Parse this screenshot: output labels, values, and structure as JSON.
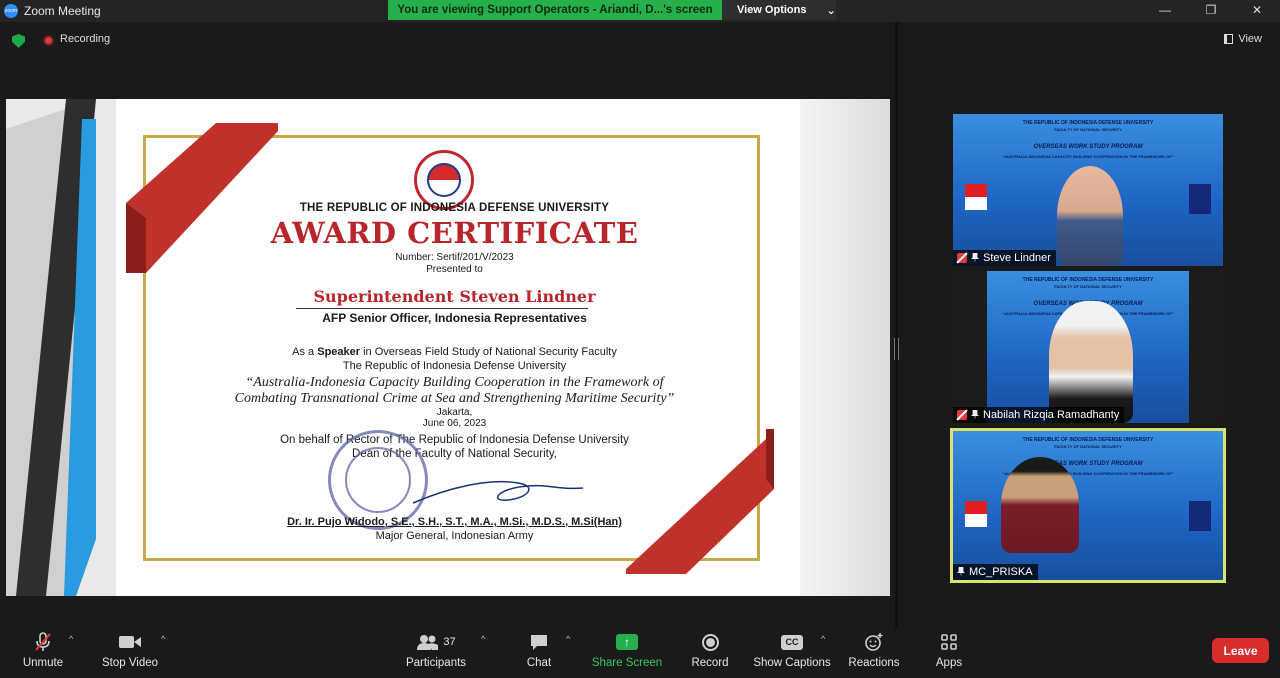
{
  "window": {
    "app_logo": "zoom",
    "title": "Zoom Meeting",
    "share_banner": "You are viewing Support Operators - Ariandi, D...'s screen",
    "view_options": "View Options",
    "controls": {
      "minimize": "—",
      "restore": "❐",
      "close": "✕"
    }
  },
  "status": {
    "recording_label": "Recording",
    "view_label": "View"
  },
  "certificate": {
    "university": "THE REPUBLIC OF INDONESIA DEFENSE UNIVERSITY",
    "heading": "AWARD CERTIFICATE",
    "number": "Number:  Sertif/201/V/2023",
    "presented_to": "Presented to",
    "recipient": "Superintendent Steven Lindner",
    "recipient_role": "AFP Senior Officer, Indonesia Representatives",
    "speaker_prefix": "As a ",
    "speaker_bold": "Speaker",
    "speaker_suffix": " in Overseas Field Study of National Security Faculty",
    "university_line": "The Republic of Indonesia Defense University",
    "quote_line1": "“Australia-Indonesia Capacity Building Cooperation in the Framework of",
    "quote_line2": "Combating Transnational Crime at Sea and Strengthening Maritime Security”",
    "city": "Jakarta,",
    "date": "June 06, 2023",
    "behalf": "On behalf of Rector of The Republic of Indonesia Defense University",
    "dean": "Dean of the Faculty of National Security,",
    "signer": "Dr. Ir. Pujo Widodo, S.E., S.H., S.T., M.A., M.Si., M.D.S., M.Si(Han)",
    "signer_rank": "Major General, Indonesian Army"
  },
  "participants_tiles": [
    {
      "name": "Steve Lindner",
      "muted": true,
      "banner": [
        "THE REPUBLIC OF INDONESIA DEFENSE UNIVERSITY",
        "FACULTY OF NATIONAL SECURITY",
        "OVERSEAS WORK STUDY PROGRAM",
        "\"AUSTRALIA-INDONESIA CAPACITY BUILDING COOPERATION IN THE FRAMEWORK OF\""
      ]
    },
    {
      "name": "Nabilah Rizqia Ramadhanty",
      "muted": true,
      "banner": [
        "THE REPUBLIC OF INDONESIA DEFENSE UNIVERSITY",
        "FACULTY OF NATIONAL SECURITY",
        "OVERSEAS WORK STUDY PROGRAM",
        "\"AUSTRALIA-INDONESIA CAPACITY BUILDING COOPERATION IN THE FRAMEWORK OF\""
      ]
    },
    {
      "name": "MC_PRISKA",
      "muted": false,
      "banner": [
        "THE REPUBLIC OF INDONESIA DEFENSE UNIVERSITY",
        "FACULTY OF NATIONAL SECURITY",
        "OVERSEAS WORK STUDY PROGRAM",
        "\"AUSTRALIA-INDONESIA CAPACITY BUILDING COOPERATION IN THE FRAMEWORK OF\""
      ]
    }
  ],
  "toolbar": {
    "unmute": "Unmute",
    "stop_video": "Stop Video",
    "participants": "Participants",
    "participants_count": "37",
    "chat": "Chat",
    "share_screen": "Share Screen",
    "record": "Record",
    "show_captions": "Show Captions",
    "captions_icon_text": "CC",
    "reactions": "Reactions",
    "apps": "Apps",
    "leave": "Leave",
    "caret": "^"
  },
  "colors": {
    "share_green": "#25b04b",
    "leave_red": "#d92c2c",
    "cert_red": "#b8262b",
    "cert_gold": "#c9a84a",
    "active_speaker": "#d8e46a"
  }
}
